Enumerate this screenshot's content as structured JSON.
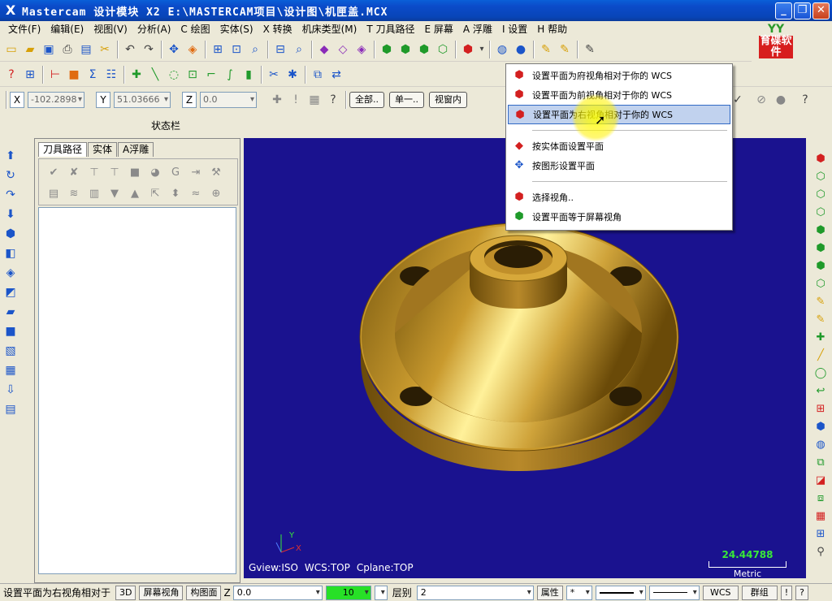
{
  "window": {
    "title": "Mastercam 设计模块  X2  E:\\MASTERCAM项目\\设计图\\机匣盖.MCX",
    "app_icon": "X",
    "min": "_",
    "max": "❐",
    "close": "✕"
  },
  "menu": [
    "文件(F)",
    "编辑(E)",
    "视图(V)",
    "分析(A)",
    "C 绘图",
    "实体(S)",
    "X 转换",
    "机床类型(M)",
    "T 刀具路径",
    "E 屏幕",
    "A 浮雕",
    "I 设置",
    "H 帮助"
  ],
  "logo": {
    "tag": "YY",
    "brand": "育碟软件"
  },
  "coords": {
    "x_label": "X",
    "x_value": "-102.2898",
    "y_label": "Y",
    "y_value": "51.03666",
    "z_label": "Z",
    "z_value": "0.0",
    "all_btn": "全部..",
    "single_btn": "单一..",
    "window_btn": "视窗内"
  },
  "status_label": "状态栏",
  "manager": {
    "tabs": [
      "刀具路径",
      "实体",
      "A浮雕"
    ]
  },
  "viewport": {
    "gview": "Gview:ISO",
    "wcs": "WCS:TOP",
    "cplane": "Cplane:TOP",
    "scale_value": "24.44788",
    "scale_unit": "Metric",
    "axis_y": "Y",
    "axis_x": "X"
  },
  "dropdown": {
    "items": [
      {
        "label": "设置平面为府视角相对于你的 WCS",
        "icon": "cube-top-icon"
      },
      {
        "label": "设置平面为前视角相对于你的 WCS",
        "icon": "cube-front-icon"
      },
      {
        "label": "设置平面为右视角相对于你的 WCS",
        "icon": "cube-right-icon",
        "highlight": true
      },
      {
        "label": "按实体面设置平面",
        "icon": "solid-face-icon"
      },
      {
        "label": "按图形设置平面",
        "icon": "geometry-plane-icon"
      },
      {
        "label": "选择视角..",
        "icon": "select-view-icon"
      },
      {
        "label": "设置平面等于屏幕视角",
        "icon": "screen-view-icon"
      }
    ]
  },
  "bottom": {
    "prompt": "设置平面为右视角相对于",
    "mode_3d": "3D",
    "screen_view": "屏幕视角",
    "cplane": "构图面",
    "z_label": "Z",
    "z_value": "0.0",
    "color_value": "10",
    "level_label": "层别",
    "level_value": "2",
    "attr": "属性",
    "point_style": "*",
    "wcs": "WCS",
    "group": "群组",
    "bang": "!",
    "help": "?"
  }
}
